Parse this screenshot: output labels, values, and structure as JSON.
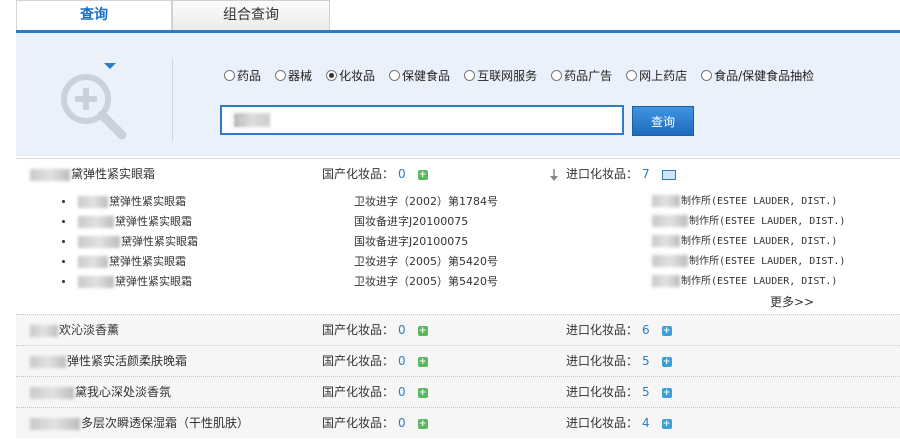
{
  "tabs": [
    {
      "label": "查询"
    },
    {
      "label": "组合查询"
    }
  ],
  "search": {
    "categories": [
      {
        "label": "药品",
        "selected": false
      },
      {
        "label": "器械",
        "selected": false
      },
      {
        "label": "化妆品",
        "selected": true
      },
      {
        "label": "保健食品",
        "selected": false
      },
      {
        "label": "互联网服务",
        "selected": false
      },
      {
        "label": "药品广告",
        "selected": false
      },
      {
        "label": "网上药店",
        "selected": false
      },
      {
        "label": "食品/保健食品抽检",
        "selected": false
      }
    ],
    "query_value": "黛",
    "button_label": "查询",
    "icons": {
      "magnifier": "zoom-in-magnifier-icon"
    }
  },
  "results": {
    "domestic_label": "国产化妆品：",
    "import_label": "进口化妆品：",
    "rows": [
      {
        "name": "黛弹性紧实眼霜",
        "domestic_count": "0",
        "import_count": "7",
        "expanded": true,
        "items": [
          {
            "name": "黛弹性紧实眼霜",
            "reg": "卫妆进字（2002）第1784号",
            "maker": "制作所(ESTEE LAUDER, DIST.)"
          },
          {
            "name": "黛弹性紧实眼霜",
            "reg": "国妆备进字J20100075",
            "maker": "制作所(ESTEE LAUDER, DIST.)"
          },
          {
            "name": "黛弹性紧实眼霜",
            "reg": "国妆备进字J20100075",
            "maker": "制作所(ESTEE LAUDER, DIST.)"
          },
          {
            "name": "黛弹性紧实眼霜",
            "reg": "卫妆进字（2005）第5420号",
            "maker": "制作所(ESTEE LAUDER, DIST.)"
          },
          {
            "name": "黛弹性紧实眼霜",
            "reg": "卫妆进字（2005）第5420号",
            "maker": "制作所(ESTEE LAUDER, DIST.)"
          }
        ],
        "more_label": "更多>>"
      },
      {
        "name": "欢沁淡香薰",
        "domestic_count": "0",
        "import_count": "6",
        "expanded": false
      },
      {
        "name": "弹性紧实活颜柔肤晚霜",
        "domestic_count": "0",
        "import_count": "5",
        "expanded": false
      },
      {
        "name": "黛我心深处淡香氛",
        "domestic_count": "0",
        "import_count": "5",
        "expanded": false
      },
      {
        "name": "多层次瞬透保湿霜（干性肌肤）",
        "domestic_count": "0",
        "import_count": "4",
        "expanded": false
      }
    ]
  },
  "colors": {
    "accent": "#2b7dc6",
    "panel_bg": "#eaf1fa",
    "plus_green": "#5cb85c",
    "plus_blue": "#3aa0d8"
  }
}
